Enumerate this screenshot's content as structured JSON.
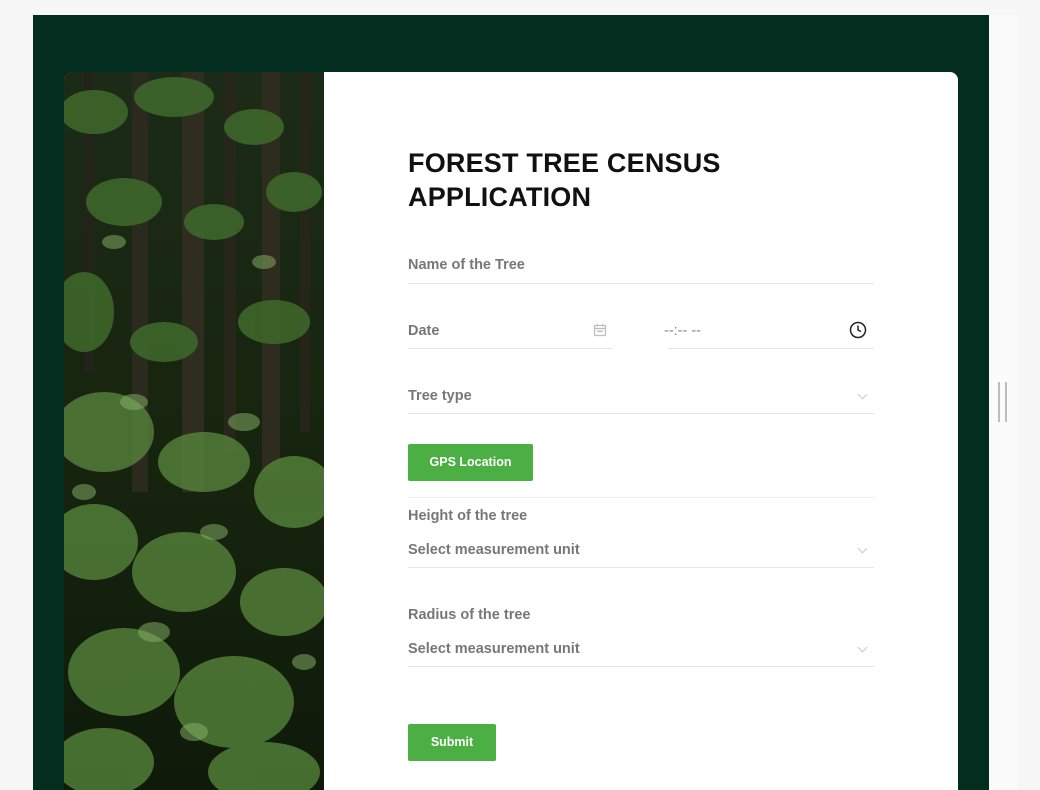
{
  "form": {
    "title": "FOREST TREE CENSUS APPLICATION",
    "tree_name_placeholder": "Name of the Tree",
    "date_placeholder": "Date",
    "time_placeholder": "--:-- --",
    "tree_type_placeholder": "Tree type",
    "gps_button_label": "GPS Location",
    "height_label": "Height of the tree",
    "height_unit_placeholder": "Select measurement unit",
    "radius_label": "Radius of the tree",
    "radius_unit_placeholder": "Select measurement unit",
    "submit_label": "Submit"
  },
  "icons": {
    "date": "calendar-icon",
    "time": "clock-icon",
    "dropdown": "chevron-down-icon"
  },
  "colors": {
    "page_background": "#032d1e",
    "card_background": "#ffffff",
    "primary_button": "#4caf43",
    "field_text": "#777777"
  }
}
